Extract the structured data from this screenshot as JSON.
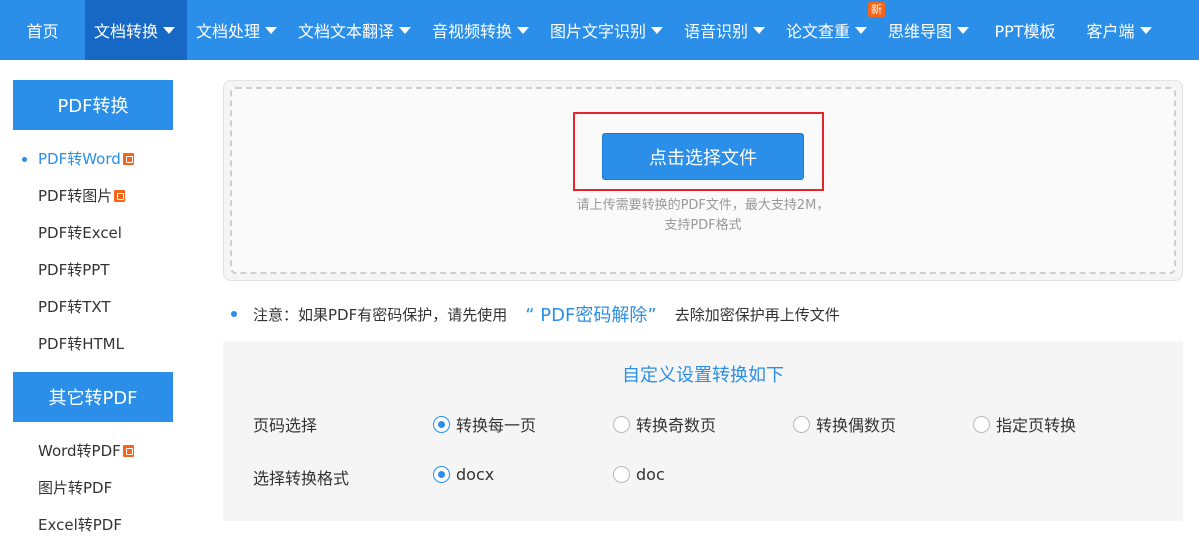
{
  "nav": {
    "items": [
      {
        "label": "首页",
        "caret": false,
        "active": false,
        "badge": ""
      },
      {
        "label": "文档转换",
        "caret": true,
        "active": true,
        "badge": ""
      },
      {
        "label": "文档处理",
        "caret": true,
        "active": false,
        "badge": ""
      },
      {
        "label": "文档文本翻译",
        "caret": true,
        "active": false,
        "badge": ""
      },
      {
        "label": "音视频转换",
        "caret": true,
        "active": false,
        "badge": ""
      },
      {
        "label": "图片文字识别",
        "caret": true,
        "active": false,
        "badge": ""
      },
      {
        "label": "语音识别",
        "caret": true,
        "active": false,
        "badge": ""
      },
      {
        "label": "论文查重",
        "caret": true,
        "active": false,
        "badge": "新"
      },
      {
        "label": "思维导图",
        "caret": true,
        "active": false,
        "badge": ""
      },
      {
        "label": "PPT模板",
        "caret": false,
        "active": false,
        "badge": ""
      },
      {
        "label": "客户端",
        "caret": true,
        "active": false,
        "badge": ""
      }
    ]
  },
  "sidebar": {
    "group1": {
      "title": "PDF转换",
      "items": [
        {
          "label": "PDF转Word",
          "active": true,
          "hot": true
        },
        {
          "label": "PDF转图片",
          "active": false,
          "hot": true
        },
        {
          "label": "PDF转Excel",
          "active": false,
          "hot": false
        },
        {
          "label": "PDF转PPT",
          "active": false,
          "hot": false
        },
        {
          "label": "PDF转TXT",
          "active": false,
          "hot": false
        },
        {
          "label": "PDF转HTML",
          "active": false,
          "hot": false
        }
      ]
    },
    "group2": {
      "title": "其它转PDF",
      "items": [
        {
          "label": "Word转PDF",
          "active": false,
          "hot": true
        },
        {
          "label": "图片转PDF",
          "active": false,
          "hot": false
        },
        {
          "label": "Excel转PDF",
          "active": false,
          "hot": false
        }
      ]
    }
  },
  "upload": {
    "button_label": "点击选择文件",
    "hint_line1": "请上传需要转换的PDF文件，最大支持2M，",
    "hint_line2": "支持PDF格式"
  },
  "notice": {
    "prefix": "注意：如果PDF有密码保护，请先使用",
    "link": "“ PDF密码解除”",
    "suffix": "去除加密保护再上传文件"
  },
  "settings": {
    "title": "自定义设置转换如下",
    "page_label": "页码选择",
    "page_options": [
      {
        "label": "转换每一页",
        "checked": true
      },
      {
        "label": "转换奇数页",
        "checked": false
      },
      {
        "label": "转换偶数页",
        "checked": false
      },
      {
        "label": "指定页转换",
        "checked": false
      }
    ],
    "format_label": "选择转换格式",
    "format_options": [
      {
        "label": "docx",
        "checked": true
      },
      {
        "label": "doc",
        "checked": false
      }
    ]
  },
  "colors": {
    "brand": "#2b8fea",
    "nav_active": "#1668c4",
    "badge": "#f5661b",
    "highlight": "#e4252a"
  }
}
